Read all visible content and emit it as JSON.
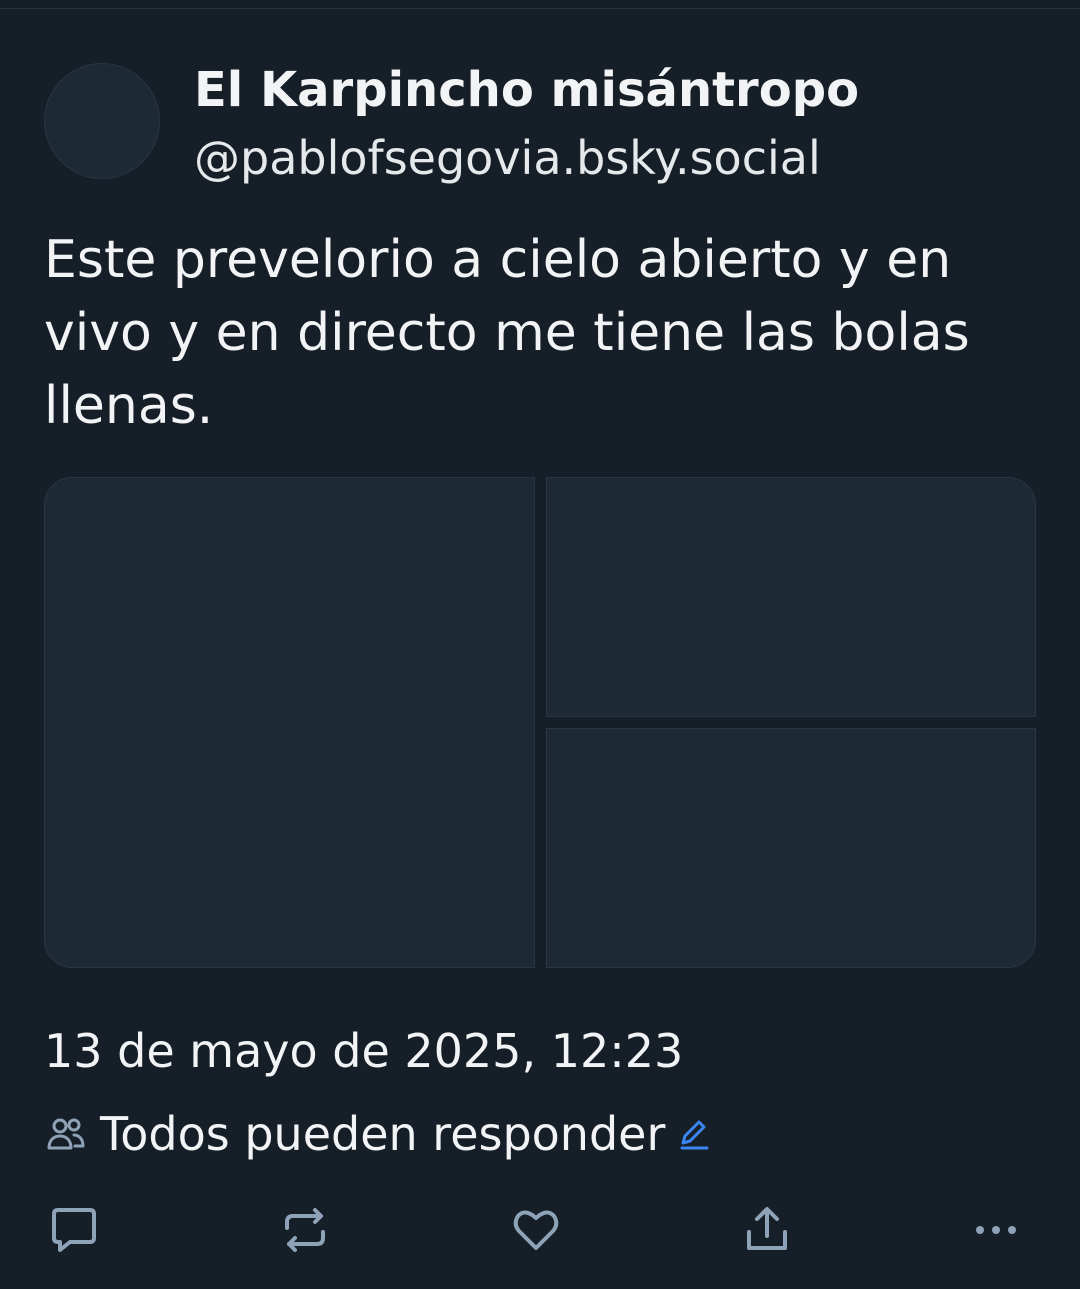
{
  "post": {
    "author": {
      "display_name": "El Karpincho misántropo",
      "handle": "@pablofsegovia.bsky.social"
    },
    "text": "Este prevelorio a cielo abierto y en vivo y en directo me tiene las bolas llenas.",
    "media": {
      "image_count": 3
    },
    "timestamp": "13 de mayo de 2025, 12:23",
    "reply_setting": {
      "label": "Todos pueden responder",
      "icon": "people-icon",
      "edit_icon": "pencil-icon"
    }
  },
  "actions": [
    {
      "name": "reply",
      "icon": "comment-icon"
    },
    {
      "name": "repost",
      "icon": "repost-icon"
    },
    {
      "name": "like",
      "icon": "heart-icon"
    },
    {
      "name": "share",
      "icon": "share-icon"
    },
    {
      "name": "more",
      "icon": "ellipsis-icon"
    }
  ],
  "colors": {
    "background": "#161e27",
    "surface": "#1e2936",
    "border": "#2a3542",
    "text": "#f1f3f5",
    "icon": "#8fa3b8",
    "accent": "#3a86f2"
  }
}
